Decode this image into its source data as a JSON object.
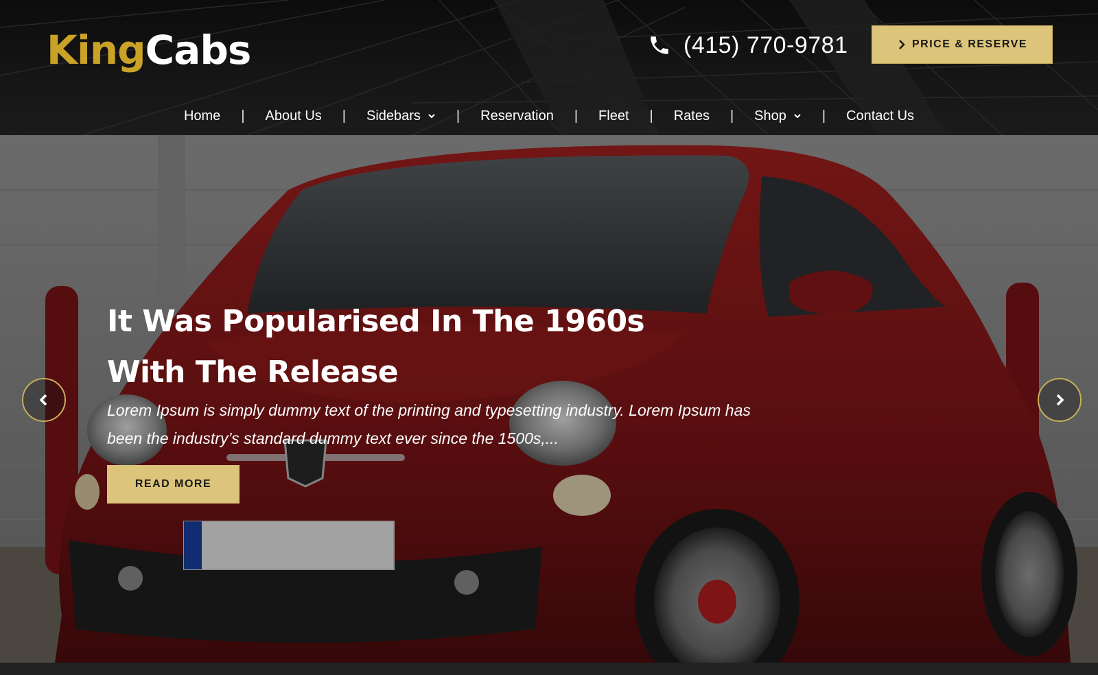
{
  "brand": {
    "name_part1": "King",
    "name_part2": "Cabs"
  },
  "contact": {
    "phone": "(415) 770-9781",
    "phone_icon": "phone-icon"
  },
  "cta": {
    "reserve_label": "PRICE & RESERVE",
    "reserve_icon": "chevron-right-icon"
  },
  "nav": {
    "separator": "|",
    "items": [
      {
        "label": "Home"
      },
      {
        "label": "About Us"
      },
      {
        "label": "Sidebars",
        "has_dropdown": true
      },
      {
        "label": "Reservation"
      },
      {
        "label": "Fleet"
      },
      {
        "label": "Rates"
      },
      {
        "label": "Shop",
        "has_dropdown": true
      },
      {
        "label": "Contact Us"
      }
    ]
  },
  "hero": {
    "title": "It Was Popularised In The 1960s With The Release",
    "text": "Lorem Ipsum is simply dummy text of the printing and typesetting industry. Lorem Ipsum has been the industry’s standard dummy text ever since the 1500s,...",
    "button_label": "READ MORE",
    "prev_icon": "chevron-left-icon",
    "next_icon": "chevron-right-icon"
  },
  "colors": {
    "accent": "#dcc47a",
    "brand_gold": "#c9a227",
    "header_bg": "#121212",
    "car_red": "#8e1a1c"
  }
}
